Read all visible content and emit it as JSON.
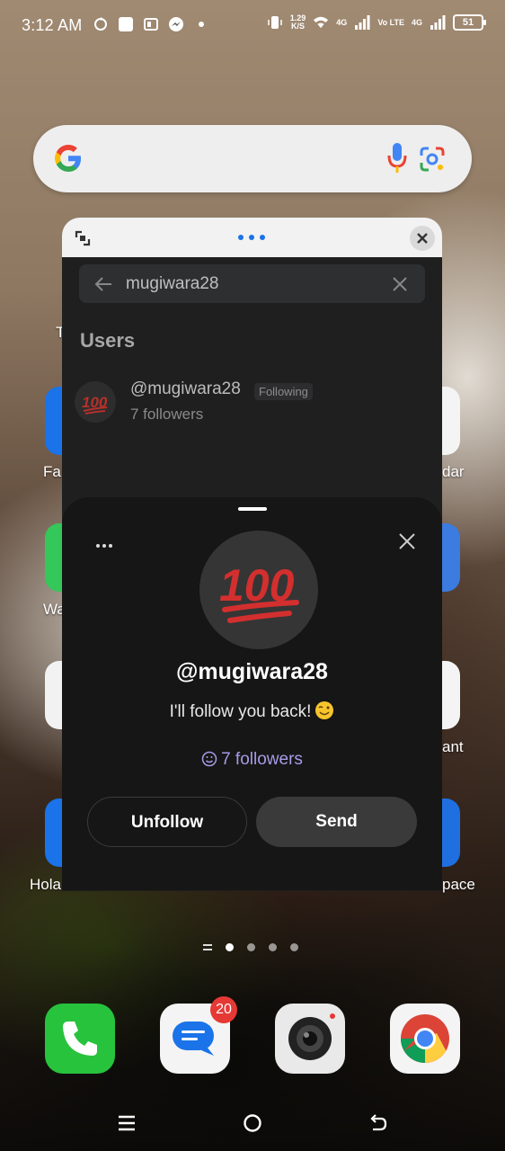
{
  "status_bar": {
    "time": "3:12 AM",
    "net_speed_value": "1.29",
    "net_speed_unit": "K/S",
    "signal1_label": "4G",
    "volte_label": "Vo LTE",
    "signal2_label": "4G",
    "battery": "51"
  },
  "search_panel": {
    "query": "mugiwara28",
    "section_title": "Users"
  },
  "user_result": {
    "handle": "@mugiwara28",
    "tag": "Following",
    "followers": "7 followers"
  },
  "profile_sheet": {
    "handle": "@mugiwara28",
    "bio": "I'll follow you back!",
    "followers": "7 followers",
    "unfollow_label": "Unfollow",
    "send_label": "Send"
  },
  "home_labels": {
    "left1": "Fa",
    "left2": "Wa",
    "left3": "Hola",
    "right1": "dar",
    "right2": "ant",
    "right3": "pace",
    "left_top": "T"
  },
  "dock": {
    "messages_badge": "20"
  },
  "colors": {
    "accent_followers": "#a79be6",
    "sheet_bg": "#161616",
    "panel_bg": "#1f1f20"
  },
  "icons": [
    "google-logo",
    "mic-icon",
    "lens-icon",
    "resize-icon",
    "close-icon",
    "back-arrow-icon",
    "clear-icon",
    "more-icon",
    "smile-icon",
    "wink-emoji",
    "hundred-emoji",
    "phone-icon",
    "messages-icon",
    "camera-icon",
    "chrome-icon"
  ]
}
